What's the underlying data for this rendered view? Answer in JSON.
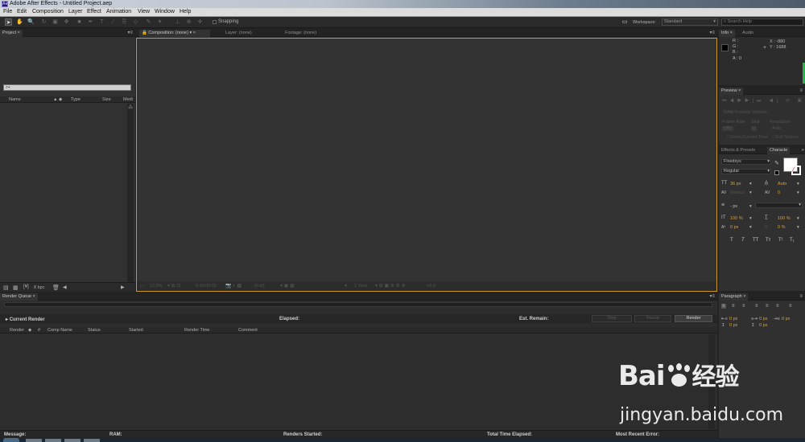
{
  "window": {
    "title": "Adobe After Effects - Untitled Project.aep",
    "app_icon": "Ae"
  },
  "menu": [
    "File",
    "Edit",
    "Composition",
    "Layer",
    "Effect",
    "Animation",
    "View",
    "Window",
    "Help"
  ],
  "toolbar": {
    "snapping_label": "Snapping",
    "workspace_label": "Workspace:",
    "workspace_value": "Standard",
    "search_placeholder": "Search Help"
  },
  "project": {
    "tab": "Project",
    "columns": [
      "Name",
      "Type",
      "Size",
      "Medi"
    ],
    "footer_bpc": "8 bpc"
  },
  "composition": {
    "tabs": [
      "Composition: (none)",
      "Layer: (none)",
      "Footage: (none)"
    ],
    "footer": {
      "zoom": "12.5%",
      "timecode": "0:00:00:00",
      "resolution": "(Full)",
      "view": "1 View",
      "exposure": "+0.0"
    }
  },
  "info": {
    "tabs": [
      "Info",
      "Audio"
    ],
    "r": "R :",
    "g": "G :",
    "b": "B :",
    "a": "A : 0",
    "x": "X : -880",
    "y": "Y : 1688"
  },
  "preview": {
    "tab": "Preview",
    "ram_options": "RAM Preview Options",
    "frame_rate_label": "Frame Rate",
    "skip_label": "Skip",
    "resolution_label": "Resolution",
    "frame_rate": "(30)",
    "skip": "0",
    "resolution": "Auto",
    "from_current": "From Current Time",
    "full_screen": "Full Screen"
  },
  "character": {
    "tabs": [
      "Effects & Presets",
      "Characte"
    ],
    "font": "Fixedsys",
    "style": "Regular",
    "size": "36 px",
    "leading": "Auto",
    "kerning": "Metrics",
    "tracking": "0",
    "stroke_width": "- px",
    "vscale": "100 %",
    "hscale": "100 %",
    "baseline": "0 px",
    "tsume": "0 %",
    "styles": [
      "T",
      "T",
      "TT",
      "Tт",
      "T¹",
      "T₁"
    ]
  },
  "paragraph": {
    "tab": "Paragraph",
    "indent_left": "0 px",
    "indent_right": "0 px",
    "indent_first": "0 px",
    "space_before": "0 px",
    "space_after": "0 px"
  },
  "render_queue": {
    "tab": "Render Queue",
    "current_render": "Current Render",
    "elapsed": "Elapsed:",
    "est_remain": "Est. Remain:",
    "stop": "Stop",
    "pause": "Pause",
    "render": "Render",
    "columns": [
      "Render",
      "#",
      "Comp Name",
      "Status",
      "Started",
      "Render Time",
      "Comment"
    ],
    "status_bar": {
      "message": "Message:",
      "ram": "RAM:",
      "renders_started": "Renders Started:",
      "total_time": "Total Time Elapsed:",
      "recent_error": "Most Recent Error:"
    }
  },
  "watermark": {
    "brand": "Bai",
    "suffix": "经验",
    "url": "jingyan.baidu.com"
  }
}
